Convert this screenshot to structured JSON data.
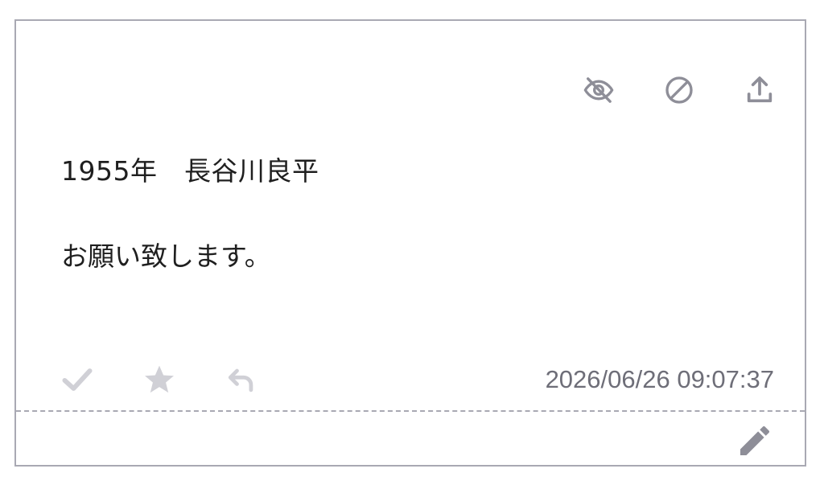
{
  "post": {
    "title": "1955年　長谷川良平",
    "body": "お願い致します。",
    "timestamp": "2026/06/26 09:07:37"
  },
  "icons": {
    "top": [
      "eye-off-icon",
      "block-icon",
      "share-icon"
    ],
    "bottom": [
      "check-icon",
      "star-icon",
      "reply-icon"
    ],
    "edit": "pencil-icon"
  },
  "colors": {
    "border": "#a9a9b3",
    "icon_dark": "#8e8e98",
    "icon_light": "#d0d0d6",
    "text": "#1f1f1f",
    "timestamp": "#6e6e78"
  }
}
